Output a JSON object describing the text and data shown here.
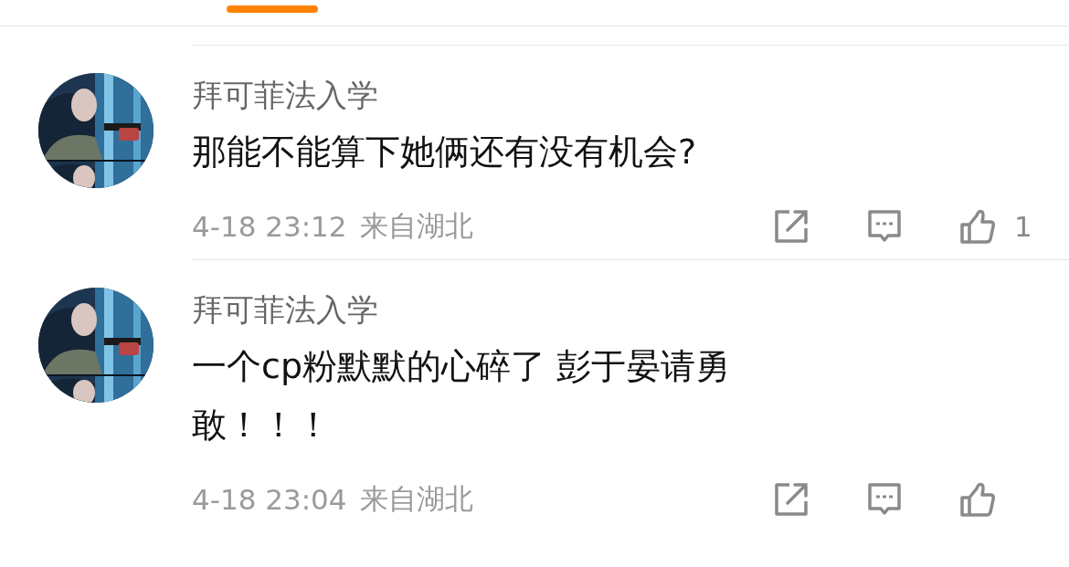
{
  "tabs": {
    "indicator": true
  },
  "comments": [
    {
      "name": "拜可菲法入学",
      "text": "那能不能算下她俩还有没有机会?",
      "time": "4-18 23:12",
      "location": "来自湖北",
      "likes": "1"
    },
    {
      "name": "拜可菲法入学",
      "text": "一个cp粉默默的心碎了 彭于晏请勇敢！！！",
      "time": "4-18 23:04",
      "location": "来自湖北"
    }
  ]
}
